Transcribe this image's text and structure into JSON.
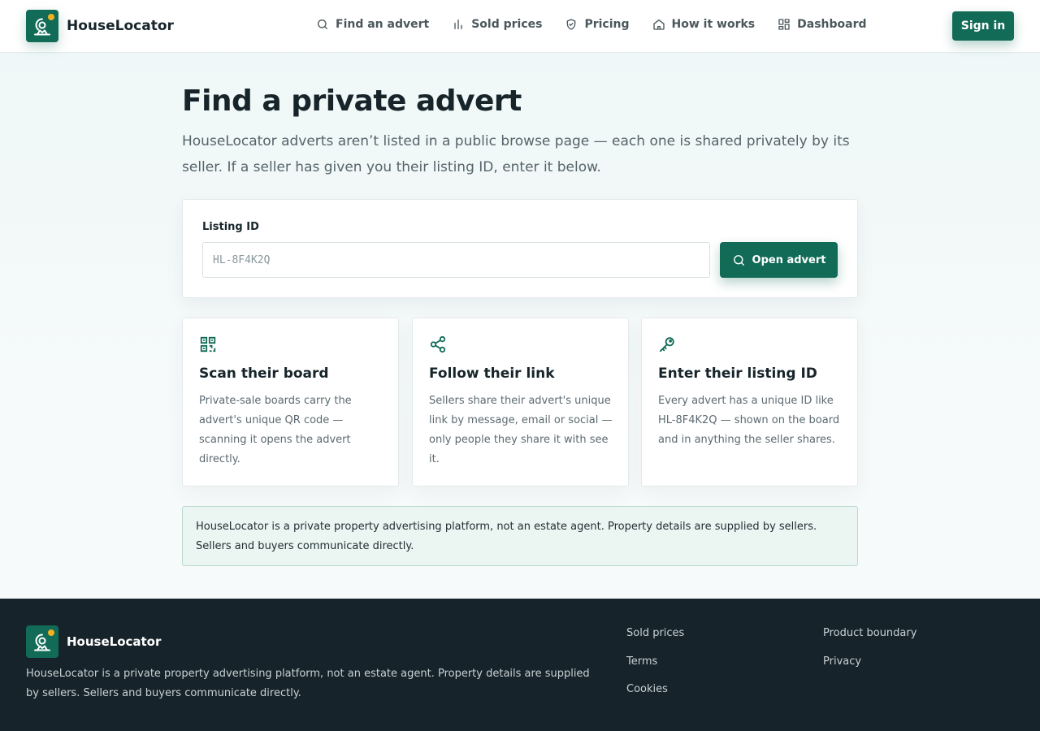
{
  "brand": {
    "name": "HouseLocator",
    "accent": "#116b57",
    "dot": "#f2b01e"
  },
  "nav": {
    "items": [
      {
        "label": "Find an advert",
        "icon": "search-icon"
      },
      {
        "label": "Sold prices",
        "icon": "bar-chart-icon"
      },
      {
        "label": "Pricing",
        "icon": "shield-check-icon"
      },
      {
        "label": "How it works",
        "icon": "home-icon"
      },
      {
        "label": "Dashboard",
        "icon": "dashboard-grid-icon"
      }
    ],
    "signin_label": "Sign in"
  },
  "main": {
    "title": "Find a private advert",
    "intro": "HouseLocator adverts aren’t listed in a public browse page — each one is shared privately by its seller. If a seller has given you their listing ID, enter it below.",
    "search": {
      "label": "Listing ID",
      "placeholder": "HL-8F4K2Q",
      "value": "",
      "button_label": "Open advert"
    },
    "cards": [
      {
        "icon": "qr-code-icon",
        "title": "Scan their board",
        "text": "Private-sale boards carry the advert's unique QR code — scanning it opens the advert directly."
      },
      {
        "icon": "share-icon",
        "title": "Follow their link",
        "text": "Sellers share their advert's unique link by message, email or social — only people they share it with see it."
      },
      {
        "icon": "key-icon",
        "title": "Enter their listing ID",
        "text": "Every advert has a unique ID like HL-8F4K2Q — shown on the board and in anything the seller shares."
      }
    ],
    "notice": "HouseLocator is a private property advertising platform, not an estate agent. Property details are supplied by sellers. Sellers and buyers communicate directly."
  },
  "footer": {
    "brand_name": "HouseLocator",
    "description": "HouseLocator is a private property advertising platform, not an estate agent. Property details are supplied by sellers. Sellers and buyers communicate directly.",
    "links_col1": [
      "Sold prices",
      "Terms",
      "Cookies"
    ],
    "links_col2": [
      "Product boundary",
      "Privacy"
    ]
  }
}
